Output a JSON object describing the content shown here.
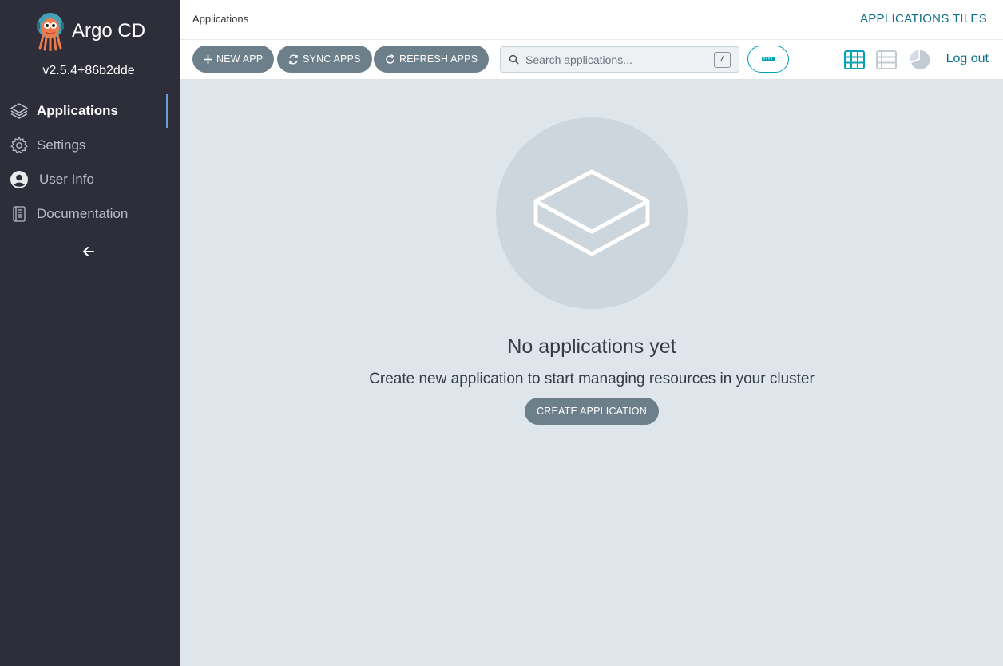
{
  "sidebar": {
    "brand": "Argo CD",
    "version": "v2.5.4+86b2dde",
    "items": [
      {
        "label": "Applications",
        "icon": "layers-icon",
        "active": true
      },
      {
        "label": "Settings",
        "icon": "gear-icon",
        "active": false
      },
      {
        "label": "User Info",
        "icon": "user-icon",
        "active": false
      },
      {
        "label": "Documentation",
        "icon": "book-icon",
        "active": false
      }
    ],
    "collapse_icon": "arrow-left-icon"
  },
  "header": {
    "breadcrumb": "Applications",
    "view_title": "APPLICATIONS TILES"
  },
  "toolbar": {
    "new_app": "NEW APP",
    "sync_apps": "SYNC APPS",
    "refresh_apps": "REFRESH APPS",
    "search_placeholder": "Search applications...",
    "search_shortcut": "/",
    "logout": "Log out"
  },
  "empty_state": {
    "title": "No applications yet",
    "subtitle": "Create new application to start managing resources in your cluster",
    "button": "CREATE APPLICATION"
  },
  "colors": {
    "sidebar_bg": "#2d2e3a",
    "accent": "#0d7085",
    "active_view": "#00a2b3",
    "button_bg": "#6d7f8b",
    "main_bg": "#dee6eb"
  }
}
